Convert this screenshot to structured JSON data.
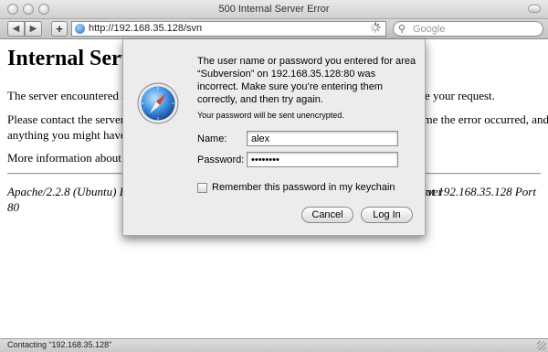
{
  "window": {
    "title": "500 Internal Server Error"
  },
  "toolbar": {
    "back_icon": "back-arrow-icon",
    "forward_icon": "forward-arrow-icon",
    "add_bookmark_icon": "plus-icon",
    "url": "http://192.168.35.128/svn",
    "search_placeholder": "Google"
  },
  "page": {
    "heading": "Internal Server Error",
    "p1": "The server encountered an internal error or misconfiguration and was unable to complete your request.",
    "p2a": "Please contact the server administrator, webmaster@localhost and inform them of the time the error occurred, and",
    "p2b": "anything you might have done that may have caused the error.",
    "p3": "More information about this error may be available in the server error log.",
    "address_a": "Apache/2.2.8 (Ubuntu) DAV/2 SVN/1.4.6 PHP/5.2.4-2ubuntu5.3 with Suhosin-Patch Server",
    "address_right": "at 192.168.35.128 Port",
    "address_b": "80"
  },
  "dialog": {
    "message": "The user name or password you entered for area “Subversion” on 192.168.35.128:80 was incorrect. Make sure you’re entering them correctly, and then try again.",
    "note": "Your password will be sent unencrypted.",
    "name_label": "Name:",
    "name_value": "alex",
    "password_label": "Password:",
    "password_value": "••••••••",
    "remember_label": "Remember this password in my keychain",
    "remember_checked": false,
    "cancel_label": "Cancel",
    "login_label": "Log In"
  },
  "status": {
    "text": "Contacting “192.168.35.128”"
  },
  "colors": {
    "chrome": "#d4d4d4",
    "sheet": "#ececec",
    "safari_blue": "#2c6fc1"
  }
}
